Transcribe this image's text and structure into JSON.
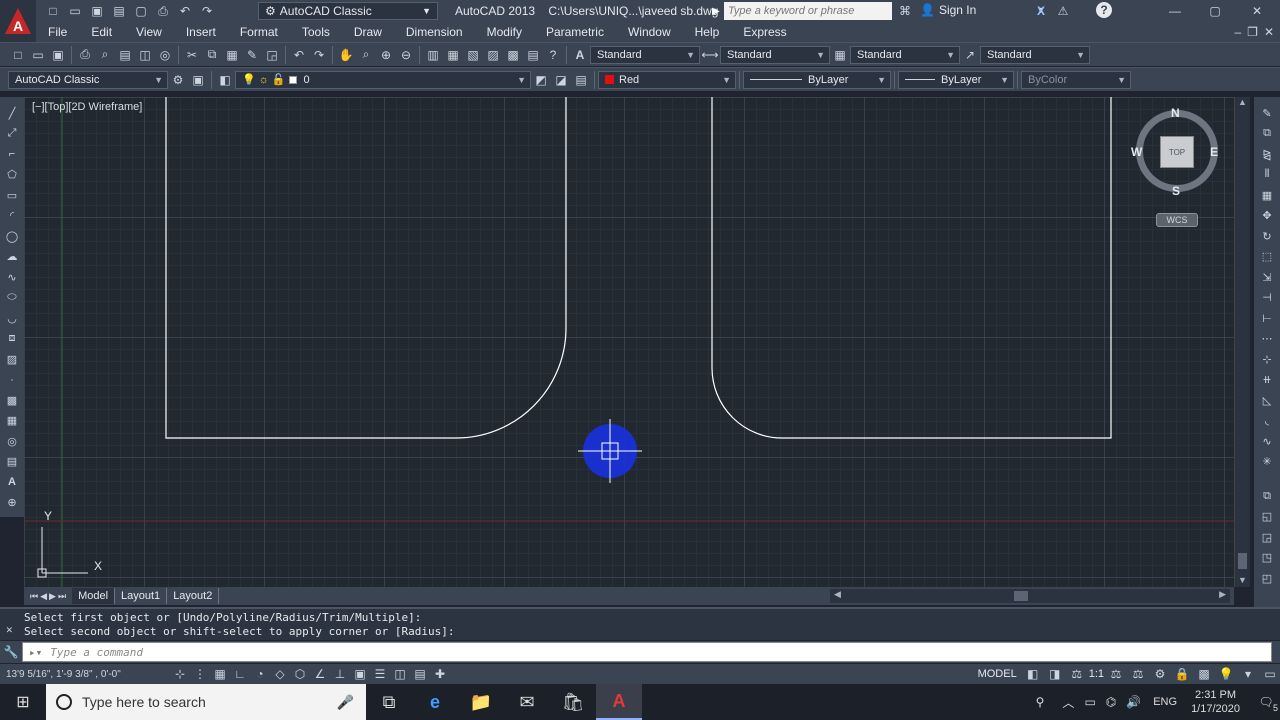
{
  "titlebar": {
    "workspace": "AutoCAD Classic",
    "title": "AutoCAD 2013    C:\\Users\\UNIQ...\\javeed sb.dwg",
    "search_placeholder": "Type a keyword or phrase",
    "sign_in": "Sign In"
  },
  "menu": [
    "File",
    "Edit",
    "View",
    "Insert",
    "Format",
    "Tools",
    "Draw",
    "Dimension",
    "Modify",
    "Parametric",
    "Window",
    "Help",
    "Express"
  ],
  "toolbar1": {
    "text_style": "Standard",
    "dim_style": "Standard",
    "table_style": "Standard",
    "mleader_style": "Standard"
  },
  "toolbar2": {
    "workspace": "AutoCAD Classic",
    "layer": "0",
    "color": "Red",
    "color_hex": "#e01010",
    "linetype": "ByLayer",
    "lineweight": "ByLayer",
    "plotstyle": "ByColor"
  },
  "viewport": {
    "label": "[−][Top][2D Wireframe]",
    "compass": {
      "n": "N",
      "s": "S",
      "e": "E",
      "w": "W",
      "cube": "TOP"
    },
    "wcs": "WCS",
    "ucs_x": "X",
    "ucs_y": "Y"
  },
  "tabs": [
    "Model",
    "Layout1",
    "Layout2"
  ],
  "command": {
    "line1": "Select first object or [Undo/Polyline/Radius/Trim/Multiple]:",
    "line2": "Select second object or shift-select to apply corner or [Radius]:",
    "placeholder": "Type a command"
  },
  "status": {
    "coords": "13'9 5/16\", 1'-9 3/8\" , 0'-0\"",
    "model": "MODEL",
    "scale": "1:1"
  },
  "taskbar": {
    "search": "Type here to search",
    "lang": "ENG",
    "time": "2:31 PM",
    "date": "1/17/2020",
    "notif_count": "5"
  }
}
